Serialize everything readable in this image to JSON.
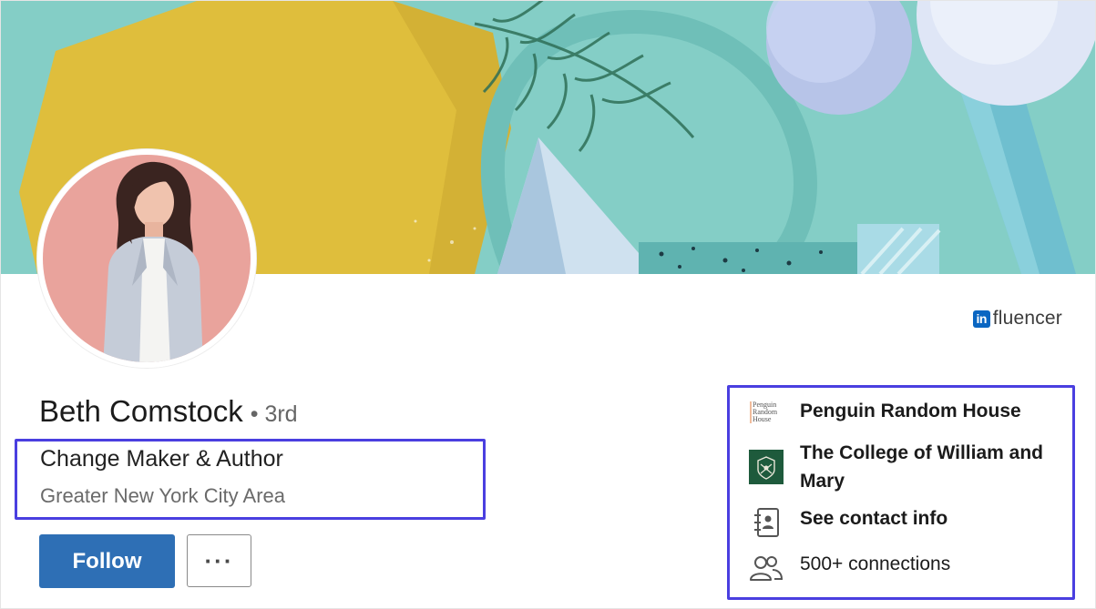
{
  "profile": {
    "name": "Beth Comstock",
    "degree": "• 3rd",
    "headline": "Change Maker & Author",
    "location": "Greater New York City Area",
    "badge": {
      "in_mark": "in",
      "word": "fluencer"
    }
  },
  "actions": {
    "follow_label": "Follow",
    "more_label": "···"
  },
  "info": {
    "company": "Penguin Random House",
    "company_logo_lines": [
      "Penguin",
      "Random",
      "House"
    ],
    "school": "The College of William and Mary",
    "contact_label": "See contact info",
    "connections": "500+ connections"
  },
  "colors": {
    "follow_button": "#2e6fb5",
    "highlight_border": "#4a3fe0",
    "banner_teal": "#7fcbc3",
    "banner_yellow": "#dfbe3c",
    "avatar_background": "#e9a39c",
    "school_logo_green": "#1e5a3c",
    "influencer_blue": "#0a66c2"
  },
  "icons": {
    "more": "ellipsis-icon",
    "contact": "address-book-icon",
    "connections": "people-icon",
    "company_logo": "penguin-random-house-logo",
    "school_logo": "william-and-mary-logo",
    "badge": "linkedin-in-icon"
  }
}
